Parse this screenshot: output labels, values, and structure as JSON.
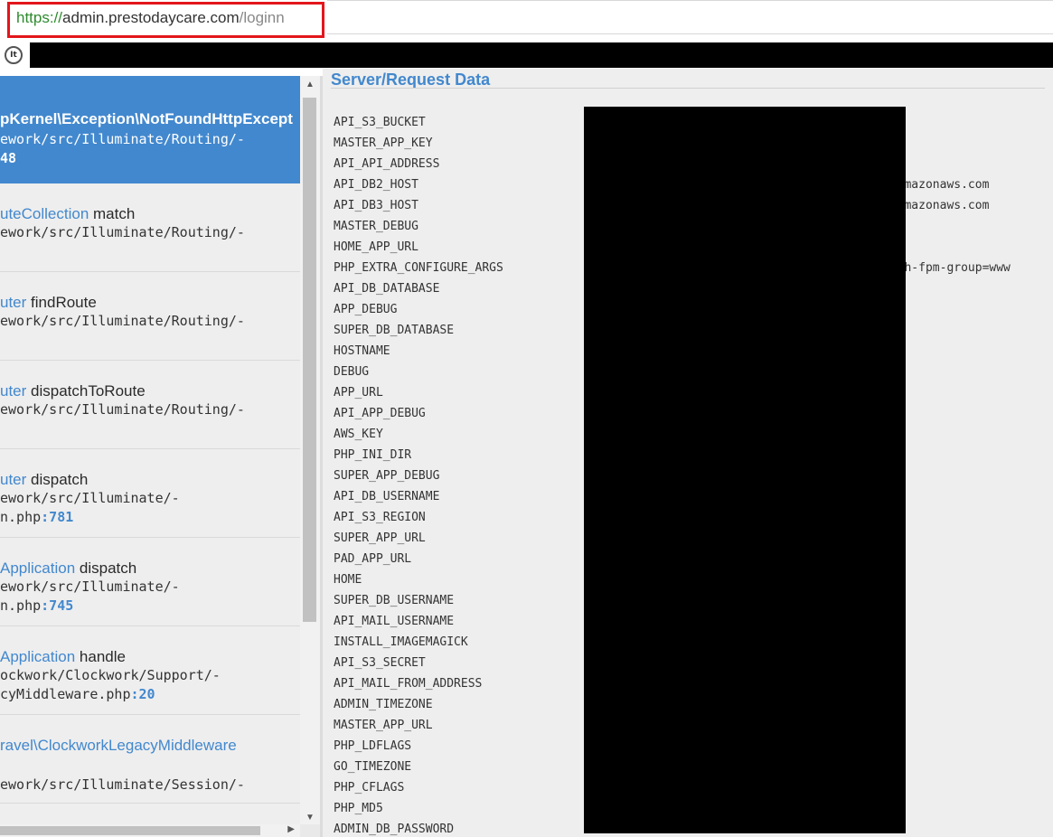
{
  "browser": {
    "url_scheme": "https://",
    "url_host": "admin.prestodaycare.com",
    "url_path": "/loginn",
    "extension_icon_label": "It"
  },
  "stack_frames": [
    {
      "class": "pKernel\\Exception\\NotFoundHttpExcept",
      "method": "",
      "file": "ework/src/Illuminate/Routing/-",
      "line_prefix": "",
      "line_number": "48",
      "active": true
    },
    {
      "class": "uteCollection",
      "method": "match",
      "file": "ework/src/Illuminate/Routing/-",
      "line_prefix": "",
      "line_number": "",
      "active": false
    },
    {
      "class": "uter",
      "method": "findRoute",
      "file": "ework/src/Illuminate/Routing/-",
      "line_prefix": "",
      "line_number": "",
      "active": false
    },
    {
      "class": "uter",
      "method": "dispatchToRoute",
      "file": "ework/src/Illuminate/Routing/-",
      "line_prefix": "",
      "line_number": "",
      "active": false
    },
    {
      "class": "uter",
      "method": "dispatch",
      "file": "ework/src/Illuminate/-",
      "line_prefix": "n.php",
      "line_number": ":781",
      "active": false
    },
    {
      "class": "Application",
      "method": "dispatch",
      "file": "ework/src/Illuminate/-",
      "line_prefix": "n.php",
      "line_number": ":745",
      "active": false
    },
    {
      "class": "Application",
      "method": "handle",
      "file": "ockwork/Clockwork/Support/-",
      "line_prefix": "cyMiddleware.php",
      "line_number": ":20",
      "active": false
    },
    {
      "class": "ravel\\ClockworkLegacyMiddleware",
      "method": "",
      "file": "",
      "line_prefix": "",
      "line_number": "",
      "active": false
    },
    {
      "class": "",
      "method": "",
      "file": "ework/src/Illuminate/Session/-",
      "line_prefix": "",
      "line_number": "",
      "active": false
    }
  ],
  "details": {
    "section_title": "Server/Request Data",
    "env_keys": [
      "API_S3_BUCKET",
      "MASTER_APP_KEY",
      "API_API_ADDRESS",
      "API_DB2_HOST",
      "API_DB3_HOST",
      "MASTER_DEBUG",
      "HOME_APP_URL",
      "PHP_EXTRA_CONFIGURE_ARGS",
      "API_DB_DATABASE",
      "APP_DEBUG",
      "SUPER_DB_DATABASE",
      "HOSTNAME",
      "DEBUG",
      "APP_URL",
      "API_APP_DEBUG",
      "AWS_KEY",
      "PHP_INI_DIR",
      "SUPER_APP_DEBUG",
      "API_DB_USERNAME",
      "API_S3_REGION",
      "SUPER_APP_URL",
      "PAD_APP_URL",
      "HOME",
      "SUPER_DB_USERNAME",
      "API_MAIL_USERNAME",
      "INSTALL_IMAGEMAGICK",
      "API_S3_SECRET",
      "API_MAIL_FROM_ADDRESS",
      "ADMIN_TIMEZONE",
      "MASTER_APP_URL",
      "PHP_LDFLAGS",
      "GO_TIMEZONE",
      "PHP_CFLAGS",
      "PHP_MD5",
      "ADMIN_DB_PASSWORD"
    ],
    "env_values": [
      "",
      "",
      "",
      "s.amazonaws.com",
      "s.amazonaws.com",
      "",
      "",
      "with-fpm-group=www",
      "",
      "",
      "",
      "",
      "",
      "",
      "",
      "",
      "",
      "",
      "",
      "",
      "",
      "",
      "",
      "",
      "",
      "",
      "",
      "",
      "",
      "",
      "",
      "",
      "",
      "",
      ""
    ]
  },
  "colors": {
    "accent": "#4288ce",
    "highlight_box": "#e2161b",
    "panel_bg": "#eeeeee",
    "redaction": "#000000"
  }
}
